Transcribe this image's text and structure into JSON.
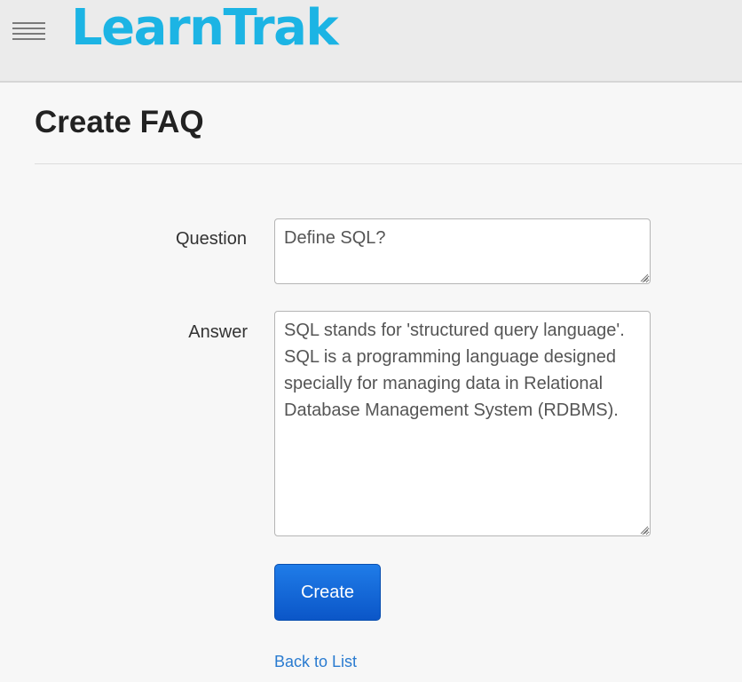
{
  "header": {
    "logo_text": "LearnTrak",
    "brand_color": "#1cb4e4",
    "menu_icon": "hamburger-menu-icon"
  },
  "page": {
    "title": "Create FAQ"
  },
  "form": {
    "question_label": "Question",
    "question_value": "Define SQL?",
    "answer_label": "Answer",
    "answer_value": "SQL stands for 'structured query language'. SQL is a programming language designed specially for managing data in Relational Database Management System (RDBMS).",
    "submit_label": "Create",
    "submit_color": "#0b56c8"
  },
  "footer_link": {
    "label": "Back to List",
    "color": "#2a7bd0"
  }
}
